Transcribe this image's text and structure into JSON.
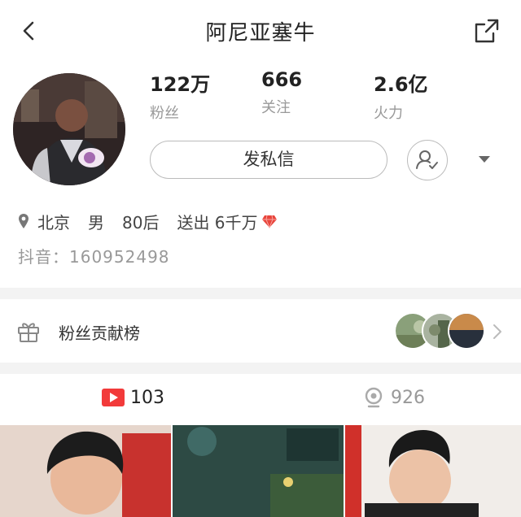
{
  "header": {
    "title": "阿尼亚塞牛"
  },
  "stats": [
    {
      "value": "122万",
      "label": "粉丝"
    },
    {
      "value": "666",
      "label": "关注"
    },
    {
      "value": "2.6亿",
      "label": "火力"
    }
  ],
  "actions": {
    "message_label": "发私信"
  },
  "profile": {
    "location": "北京",
    "gender": "男",
    "generation": "80后",
    "sent_gifts": "送出 6千万",
    "douyin_id": "抖音：160952498"
  },
  "fans_rank": {
    "label": "粉丝贡献榜"
  },
  "tabs": [
    {
      "icon": "video-play-icon",
      "count": "103"
    },
    {
      "icon": "live-camera-icon",
      "count": "926"
    }
  ],
  "colors": {
    "accent_red": "#f23a3a",
    "gem_red": "#e8453c",
    "muted_text": "#999999",
    "divider": "#f3f3f3"
  }
}
